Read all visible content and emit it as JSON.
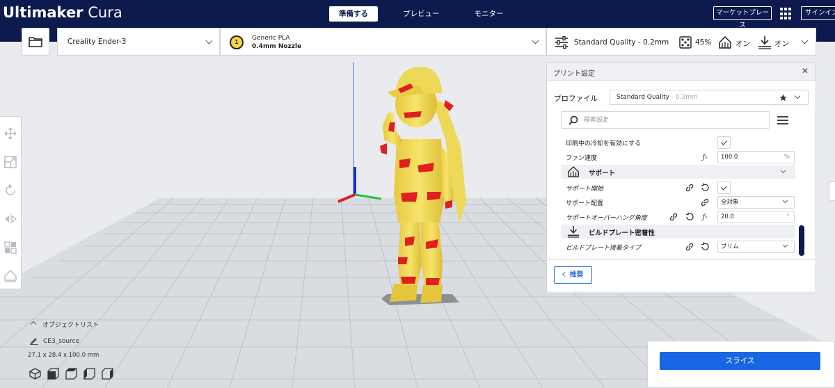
{
  "app": {
    "brand_bold": "Ultimaker",
    "brand_light": "Cura"
  },
  "stages": [
    {
      "label": "準備する",
      "active": true
    },
    {
      "label": "プレビュー",
      "active": false
    },
    {
      "label": "モニター",
      "active": false
    }
  ],
  "topbar": {
    "marketplace_label": "マーケットプレース",
    "signin_label": "サインイン"
  },
  "machine": {
    "name": "Creality Ender-3"
  },
  "material": {
    "extruder_number": "1",
    "name": "Generic PLA",
    "nozzle": "0.4mm Nozzle"
  },
  "print_setup": {
    "quality": "Standard Quality - 0.2mm",
    "infill": "45%",
    "support": "オン",
    "adhesion": "オン"
  },
  "panel": {
    "title": "プリント設定",
    "close": "✕",
    "profile_label": "プロファイル",
    "profile_value": "Standard Quality",
    "profile_hint": " - 0.2mm",
    "search_placeholder": "検索設定",
    "recommended_label": "推奨"
  },
  "settings": {
    "enable_cooling": {
      "label": "印刷中の冷却を有効にする",
      "checked": true
    },
    "fan_speed": {
      "label": "ファン速度",
      "value": "100.0",
      "unit": "%"
    },
    "support_category": {
      "label": "サポート"
    },
    "support_enable": {
      "label": "サポート開始",
      "checked": true
    },
    "support_placement": {
      "label": "サポート配置",
      "value": "全対象"
    },
    "support_angle": {
      "label": "サポートオーバーハング角度",
      "value": "20.0",
      "unit": "°"
    },
    "adhesion_category": {
      "label": "ビルドプレート密着性"
    },
    "adhesion_type": {
      "label": "ビルドプレート接着タイプ",
      "value": "ブリム"
    }
  },
  "object_list": {
    "title": "オブジェクトリスト",
    "filename": "CE3_source",
    "dimensions": "27.1 x 28.4 x 100.0 mm"
  },
  "slice": {
    "label": "スライス"
  },
  "colors": {
    "header_navy": "#0c1a4e",
    "primary_blue": "#1966e3",
    "model_yellow": "#f5e063",
    "overhang_red": "#e02020",
    "build_plate": "#d4d7dc"
  },
  "icons": {
    "open": "folder-icon",
    "settings": "sliders-icon",
    "infill": "infill-icon",
    "support": "support-icon",
    "adhesion": "adhesion-icon",
    "tools": [
      "move-icon",
      "scale-icon",
      "rotate-icon",
      "mirror-icon",
      "per-model-settings-icon",
      "support-blocker-icon"
    ],
    "views": [
      "3d-view-icon",
      "front-view-icon",
      "top-view-icon",
      "left-view-icon",
      "right-view-icon"
    ]
  }
}
